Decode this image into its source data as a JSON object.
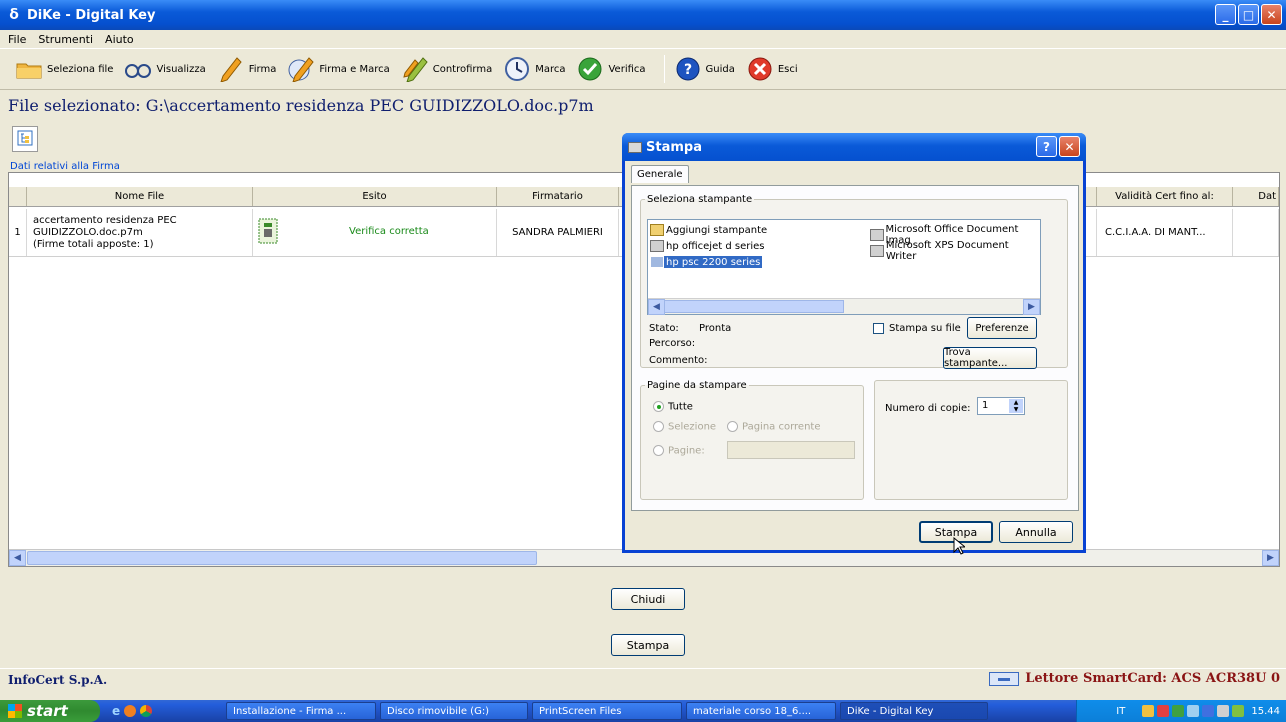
{
  "window": {
    "title": "DiKe - Digital Key"
  },
  "menu": [
    "File",
    "Strumenti",
    "Aiuto"
  ],
  "toolbar": [
    {
      "label": "Seleziona file",
      "icon": "folder-icon"
    },
    {
      "label": "Visualizza",
      "icon": "glasses-icon"
    },
    {
      "label": "Firma",
      "icon": "pen-icon"
    },
    {
      "label": "Firma e Marca",
      "icon": "pen-clock-icon"
    },
    {
      "label": "Controfirma",
      "icon": "countersign-pen-icon"
    },
    {
      "label": "Marca",
      "icon": "clock-icon"
    },
    {
      "label": "Verifica",
      "icon": "check-icon"
    },
    {
      "label": "Guida",
      "icon": "help-icon"
    },
    {
      "label": "Esci",
      "icon": "exit-icon"
    }
  ],
  "file_selected": "File selezionato: G:\\accertamento residenza PEC GUIDIZZOLO.doc.p7m",
  "group_label": "Dati relativi alla Firma",
  "grid": {
    "headers": [
      "Nome File",
      "Esito",
      "Firmatario",
      "Validità Cert fino al:",
      "Dat"
    ],
    "row": {
      "index": "1",
      "filename": "accertamento residenza PEC GUIDIZZOLO.doc.p7m",
      "filename_l1": "accertamento residenza PEC",
      "filename_l2": "GUIDIZZOLO.doc.p7m",
      "filename_l3": "(Firme totali apposte: 1)",
      "esito": "Verifica corretta",
      "firmatario": "SANDRA PALMIERI",
      "issuer": "C.C.I.A.A. DI MANT..."
    }
  },
  "buttons": {
    "chiudi": "Chiudi",
    "stampa": "Stampa"
  },
  "status": {
    "company": "InfoCert S.p.A.",
    "reader": "Lettore SmartCard: ACS ACR38U 0"
  },
  "dialog": {
    "title": "Stampa",
    "tab": "Generale",
    "printer_group": "Seleziona stampante",
    "printers_left": [
      "Aggiungi stampante",
      "hp officejet d series",
      "hp psc 2200 series"
    ],
    "printers_right": [
      "Microsoft Office Document Imag",
      "Microsoft XPS Document Writer"
    ],
    "stato_label": "Stato:",
    "stato_value": "Pronta",
    "percorso_label": "Percorso:",
    "commento_label": "Commento:",
    "print_to_file": "Stampa su file",
    "preferenze": "Preferenze",
    "trova": "Trova stampante...",
    "pages_group": "Pagine da stampare",
    "tutte": "Tutte",
    "selezione": "Selezione",
    "pagina_corrente": "Pagina corrente",
    "pagine": "Pagine:",
    "copies_label": "Numero di copie:",
    "copies_value": "1",
    "stampa": "Stampa",
    "annulla": "Annulla"
  },
  "taskbar": {
    "start": "start",
    "tasks": [
      "Installazione - Firma ...",
      "Disco rimovibile (G:)",
      "PrintScreen Files",
      "materiale corso 18_6....",
      "DiKe - Digital Key"
    ],
    "lang": "IT",
    "clock": "15.44"
  }
}
